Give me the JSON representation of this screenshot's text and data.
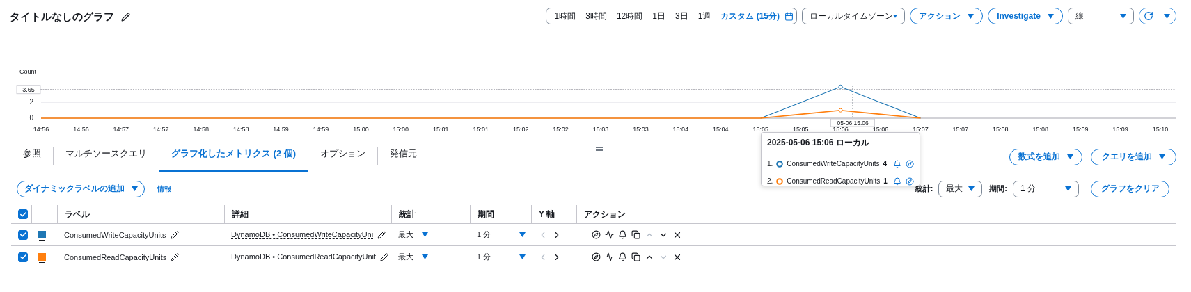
{
  "title": "タイトルなしのグラフ",
  "time_range": {
    "options": [
      {
        "label": "1時間",
        "selected": false
      },
      {
        "label": "3時間",
        "selected": false
      },
      {
        "label": "12時間",
        "selected": false
      },
      {
        "label": "1日",
        "selected": false
      },
      {
        "label": "3日",
        "selected": false
      },
      {
        "label": "1週",
        "selected": false
      },
      {
        "label": "カスタム (15分)",
        "selected": true
      }
    ]
  },
  "timezone_select": {
    "value": "ローカルタイムゾーン"
  },
  "header_buttons": [
    "アクション",
    "Investigate"
  ],
  "graph_type_select": {
    "value": "線"
  },
  "chart": {
    "chart_data": {
      "type": "line",
      "ylabel": "Count",
      "ylim": [
        0,
        4.3
      ],
      "yticks": [
        0,
        2
      ],
      "categories": [
        "14:56",
        "14:56",
        "14:57",
        "14:57",
        "14:58",
        "14:58",
        "14:59",
        "14:59",
        "15:00",
        "15:00",
        "15:01",
        "15:01",
        "15:02",
        "15:02",
        "15:03",
        "15:03",
        "15:04",
        "15:04",
        "15:05",
        "15:05",
        "15:06",
        "15:06",
        "15:07",
        "15:07",
        "15:08",
        "15:08",
        "15:09",
        "15:09",
        "15:10"
      ],
      "series": [
        {
          "name": "ConsumedWriteCapacityUnits",
          "color": "#1f77b4",
          "values": [
            null,
            null,
            null,
            null,
            null,
            null,
            null,
            null,
            null,
            null,
            null,
            null,
            null,
            null,
            null,
            null,
            null,
            null,
            0,
            2,
            4,
            2,
            0,
            null,
            null,
            null,
            null,
            null,
            null
          ]
        },
        {
          "name": "ConsumedReadCapacityUnits",
          "color": "#ff7f0e",
          "values": [
            0,
            0,
            0,
            0,
            0,
            0,
            0,
            0,
            0,
            0,
            0,
            0,
            0,
            0,
            0,
            0,
            0,
            0,
            0,
            0.5,
            1,
            0.5,
            0,
            null,
            null,
            null,
            null,
            null,
            null
          ]
        }
      ],
      "ref_lines": [
        {
          "axis": "y",
          "value": 3.65,
          "label": "3.65"
        },
        {
          "axis": "x",
          "value": "15:06",
          "label": "05-06 15:06"
        }
      ]
    }
  },
  "tooltip": {
    "title": "2025-05-06 15:06 ローカル",
    "items": [
      {
        "index": "1.",
        "value": "4"
      },
      {
        "index": "2.",
        "value": "1"
      }
    ]
  },
  "tabs": [
    {
      "label": "参照",
      "selected": false
    },
    {
      "label": "マルチソースクエリ",
      "selected": false
    },
    {
      "label": "グラフ化したメトリクス (2 個)",
      "selected": true
    },
    {
      "label": "オプション",
      "selected": false
    },
    {
      "label": "発信元",
      "selected": false
    }
  ],
  "tab_buttons": [
    "数式を追加",
    "クエリを追加"
  ],
  "dynamic_label_button": "ダイナミックラベルの追加",
  "info_link": "情報",
  "stat": {
    "label": "統計:",
    "value": "最大"
  },
  "period": {
    "label": "期間:",
    "value": "1 分"
  },
  "clear_button": "グラフをクリア",
  "table": {
    "select_all_checked": true,
    "columns": [
      "ラベル",
      "詳細",
      "統計",
      "期間",
      "Y 軸",
      "アクション"
    ],
    "rows": [
      {
        "checked": true,
        "color": "#1f77b4",
        "label": "ConsumedWriteCapacityUnits",
        "detail": "DynamoDB • ConsumedWriteCapacityUni",
        "stat": "最大",
        "period": "1 分",
        "y_left_disabled": true,
        "y_right_disabled": false,
        "up_disabled": true,
        "down_disabled": false
      },
      {
        "checked": true,
        "color": "#ff7f0e",
        "label": "ConsumedReadCapacityUnits",
        "detail": "DynamoDB • ConsumedReadCapacityUnit",
        "stat": "最大",
        "period": "1 分",
        "y_left_disabled": true,
        "y_right_disabled": false,
        "up_disabled": false,
        "down_disabled": true
      }
    ]
  }
}
